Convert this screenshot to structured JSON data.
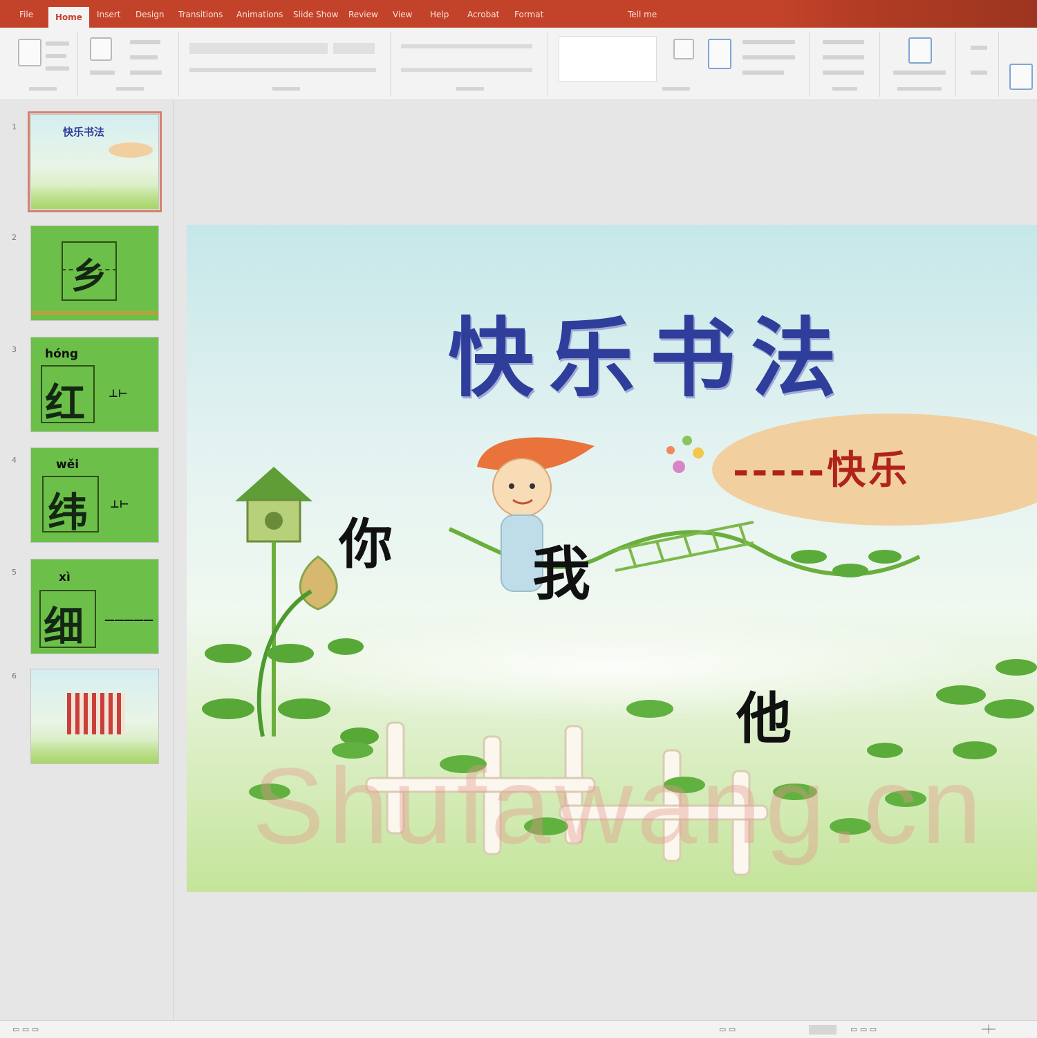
{
  "ribbon": {
    "tabs": [
      "File",
      "Home",
      "Insert",
      "Design",
      "Transitions",
      "Animations",
      "Slide Show",
      "Review",
      "View",
      "Help",
      "Acrobat",
      "Format",
      "Tell me"
    ],
    "active_tab_index": 1
  },
  "thumbnails": [
    {
      "number": "1",
      "pinyin": "",
      "char": "",
      "selected": true
    },
    {
      "number": "2",
      "pinyin": "",
      "char": "乡"
    },
    {
      "number": "3",
      "pinyin": "hóng",
      "char": "红"
    },
    {
      "number": "4",
      "pinyin": "wěi",
      "char": "纬"
    },
    {
      "number": "5",
      "pinyin": "xì",
      "char": "细"
    },
    {
      "number": "6",
      "pinyin": "",
      "char": ""
    }
  ],
  "slide": {
    "title": "快乐书法",
    "subtitle": "-----快乐",
    "words": [
      "你",
      "我",
      "他"
    ]
  },
  "watermark": "Shufawang.cn",
  "colors": {
    "title_bar": "#c3432a",
    "title_text": "#2f3e9a",
    "subtitle_text": "#b0231c",
    "thumb_green": "#6cc04a"
  }
}
